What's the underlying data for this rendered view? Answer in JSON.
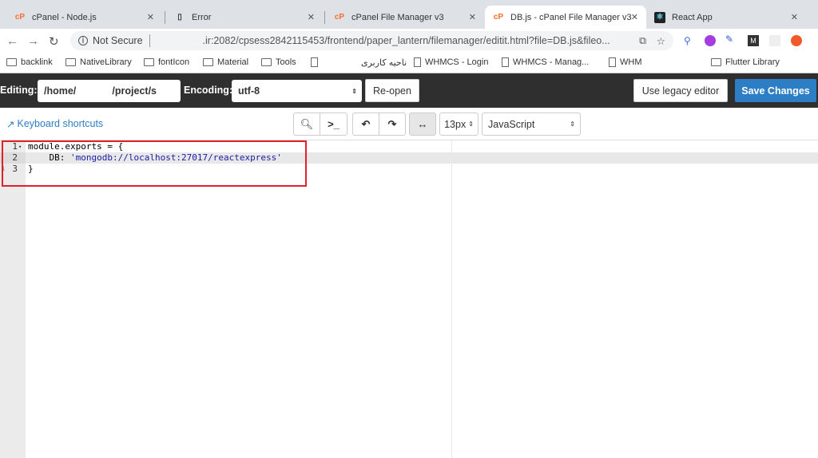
{
  "browser": {
    "tabs": [
      {
        "title": "cPanel - Node.js",
        "icon": "cpanel-icon"
      },
      {
        "title": "Error",
        "icon": "page-icon"
      },
      {
        "title": "cPanel File Manager v3",
        "icon": "cpanel-icon"
      },
      {
        "title": "DB.js - cPanel File Manager v3",
        "icon": "cpanel-icon",
        "active": true
      },
      {
        "title": "React App",
        "icon": "react-icon"
      }
    ],
    "security": "Not Secure",
    "url": ".ir:2082/cpsess2842115453/frontend/paper_lantern/filemanager/editit.html?file=DB.js&fileo...",
    "bookmarks": [
      {
        "label": "backlink",
        "icon": "folder-icon"
      },
      {
        "label": "NativeLibrary",
        "icon": "folder-icon"
      },
      {
        "label": "fontIcon",
        "icon": "folder-icon"
      },
      {
        "label": "Material",
        "icon": "folder-icon"
      },
      {
        "label": "Tools",
        "icon": "folder-icon"
      },
      {
        "label": "",
        "icon": "page-icon"
      },
      {
        "label": "ناحیه کاربری",
        "icon": "page-icon"
      },
      {
        "label": "WHMCS - Login",
        "icon": "page-icon"
      },
      {
        "label": "WHMCS - Manag...",
        "icon": "page-icon"
      },
      {
        "label": "WHM",
        "icon": "page-icon"
      },
      {
        "label": "Flutter Library",
        "icon": "folder-icon"
      }
    ]
  },
  "editor_bar": {
    "editing_label": "Editing:",
    "path": "/home/             /project/s",
    "encoding_label": "Encoding:",
    "encoding": "utf-8",
    "reopen": "Re-open",
    "legacy": "Use legacy editor",
    "save": "Save Changes",
    "save_color": "#2d7ec4"
  },
  "toolbar": {
    "shortcuts": "Keyboard shortcuts",
    "font_size": "13px",
    "mode": "JavaScript"
  },
  "code": {
    "lines": [
      {
        "n": "1",
        "text": "module.exports = {"
      },
      {
        "n": "2",
        "prefix": "    DB: ",
        "str": "'mongodb://localhost:27017/reactexpress'"
      },
      {
        "n": "3",
        "text": "}"
      }
    ]
  }
}
